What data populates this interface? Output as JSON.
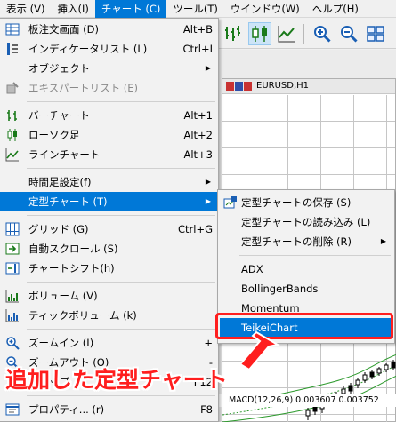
{
  "menubar": {
    "items": [
      {
        "label": "表示 (V)"
      },
      {
        "label": "挿入(I)"
      },
      {
        "label": "チャート (C)"
      },
      {
        "label": "ツール(T)"
      },
      {
        "label": "ウインドウ(W)"
      },
      {
        "label": "ヘルプ(H)"
      }
    ]
  },
  "chart_window": {
    "title": "EURUSD,H1"
  },
  "macd_label": "MACD(12,26,9) 0.003607 0.003752",
  "menu": {
    "items": [
      {
        "label": "板注文画面 (D)",
        "shortcut": "Alt+B",
        "icon": "order-board-icon"
      },
      {
        "label": "インディケータリスト (L)",
        "shortcut": "Ctrl+I",
        "icon": "indicator-list-icon"
      },
      {
        "label": "オブジェクト",
        "icon": "none"
      },
      {
        "label": "エキスパートリスト (E)",
        "icon": "expert-list-icon"
      },
      {
        "label": "バーチャート",
        "shortcut": "Alt+1",
        "icon": "bar-chart-icon"
      },
      {
        "label": "ローソク足",
        "shortcut": "Alt+2",
        "icon": "candlestick-icon"
      },
      {
        "label": "ラインチャート",
        "shortcut": "Alt+3",
        "icon": "line-chart-icon"
      },
      {
        "label": "時間足設定(f)"
      },
      {
        "label": "定型チャート (T)"
      },
      {
        "label": "グリッド (G)",
        "shortcut": "Ctrl+G",
        "icon": "grid-icon"
      },
      {
        "label": "自動スクロール (S)",
        "icon": "auto-scroll-icon"
      },
      {
        "label": "チャートシフト(h)",
        "icon": "chart-shift-icon"
      },
      {
        "label": "ボリューム (V)",
        "icon": "volume-icon"
      },
      {
        "label": "ティックボリューム (k)",
        "icon": "tick-volume-icon"
      },
      {
        "label": "ズームイン (I)",
        "shortcut": "+",
        "icon": "zoom-in-icon"
      },
      {
        "label": "ズームアウト (O)",
        "shortcut": "-",
        "icon": "zoom-out-icon"
      },
      {
        "label": "ステップ",
        "shortcut": "F12"
      },
      {
        "label": "プロパティ... (r)",
        "shortcut": "F8",
        "icon": "properties-icon"
      }
    ]
  },
  "submenu": {
    "items": [
      {
        "label": "定型チャートの保存 (S)",
        "icon": "save-template-icon"
      },
      {
        "label": "定型チャートの読み込み (L)"
      },
      {
        "label": "定型チャートの削除 (R)"
      },
      {
        "label": "ADX"
      },
      {
        "label": "BollingerBands"
      },
      {
        "label": "Momentum"
      },
      {
        "label": "TeikeiChart"
      }
    ]
  },
  "annotation": {
    "text": "追加した定型チャート"
  },
  "colors": {
    "highlight": "#0078d7",
    "annotation": "#ff1e1e"
  }
}
